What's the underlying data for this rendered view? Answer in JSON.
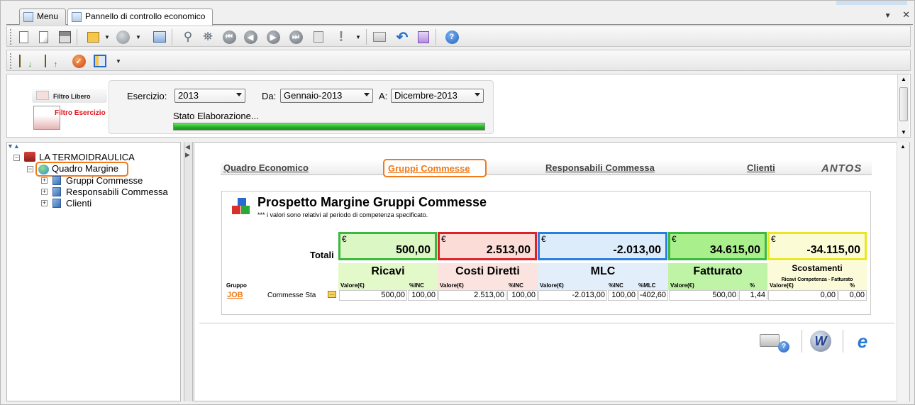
{
  "tabs": [
    {
      "label": "Menu"
    },
    {
      "label": "Pannello di controllo economico"
    }
  ],
  "filter": {
    "filtro_libero": "Filtro Libero",
    "filtro_esercizio": "Filtro Esercizio",
    "esercizio_label": "Esercizio:",
    "esercizio_value": "2013",
    "da_label": "Da:",
    "da_value": "Gennaio-2013",
    "a_label": "A:",
    "a_value": "Dicembre-2013",
    "stato_label": "Stato Elaborazione...",
    "progress": 1.0
  },
  "tree": {
    "root": "LA TERMOIDRAULICA",
    "selected": "Quadro Margine",
    "children": [
      "Gruppi Commesse",
      "Responsabili Commessa",
      "Clienti"
    ]
  },
  "report_tabs": [
    {
      "label": "Quadro Economico"
    },
    {
      "label": "Gruppi Commesse"
    },
    {
      "label": "Responsabili Commessa"
    },
    {
      "label": "Clienti"
    }
  ],
  "brand": "ANTOS",
  "report": {
    "title": "Prospetto Margine Gruppi Commesse",
    "note": "*** i valori sono relativi al periodo di competenza specificato.",
    "totali_label": "Totali",
    "currency": "€",
    "totals": {
      "ricavi": "500,00",
      "costi": "2.513,00",
      "mlc": "-2.013,00",
      "fatturato": "34.615,00",
      "scostamenti": "-34.115,00"
    },
    "headers": {
      "ricavi": "Ricavi",
      "costi": "Costi Diretti",
      "mlc": "MLC",
      "fatturato": "Fatturato",
      "scostamenti": "Scostamenti",
      "scostamenti_sub": "Ricavi Competenza - Fatturato"
    },
    "sub": {
      "gruppo": "Gruppo",
      "valore": "Valore(€)",
      "inc": "%INC",
      "mlc_pct": "%MLC",
      "pct": "%"
    },
    "row": {
      "code": "JOB",
      "name": "Commesse Sta",
      "ricavi": "500,00",
      "ricavi_inc": "100,00",
      "costi": "2.513,00",
      "costi_inc": "100,00",
      "mlc": "-2.013,00",
      "mlc_inc": "100,00",
      "mlc_pct": "-402,60",
      "fatturato": "500,00",
      "fatturato_pct": "1,44",
      "scost": "0,00",
      "scost_pct": "0,00"
    }
  },
  "colors": {
    "accent": "#f07a1a",
    "ricavi_border": "#3cb83c",
    "costi_border": "#e0202a",
    "mlc_border": "#2a7de0",
    "fatt_border": "#3cb83c",
    "scost_border": "#e8e820"
  }
}
